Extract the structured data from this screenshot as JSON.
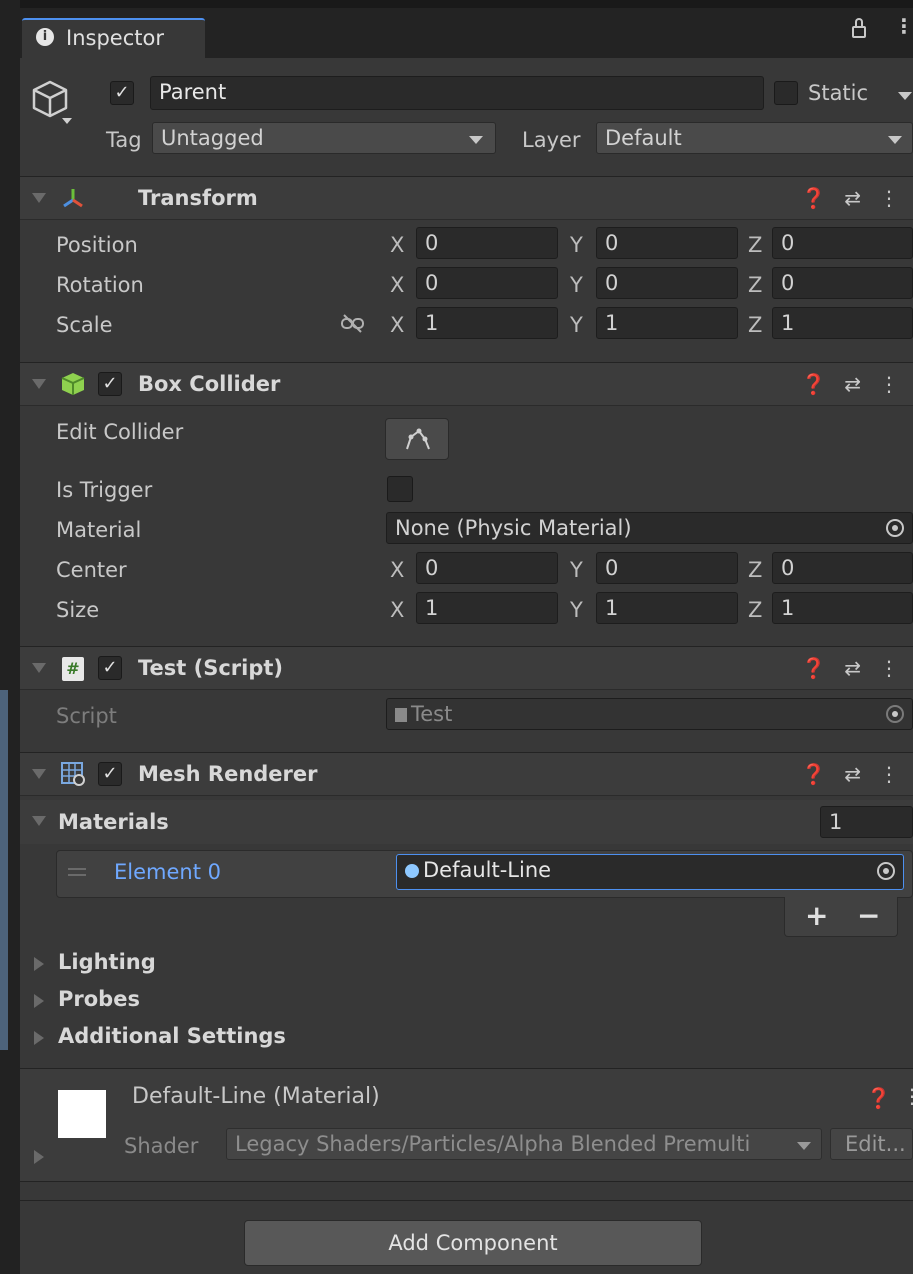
{
  "window": {
    "tab_label": "Inspector",
    "tab_icon": "info-icon",
    "lock_icon": "lock-icon",
    "menu_icon": "kebab-menu-icon"
  },
  "gameobject": {
    "name": "Parent",
    "active": true,
    "static_label": "Static",
    "tag_label": "Tag",
    "tag_value": "Untagged",
    "layer_label": "Layer",
    "layer_value": "Default"
  },
  "transform": {
    "title": "Transform",
    "rows": [
      {
        "label": "Position",
        "x": "0",
        "y": "0",
        "z": "0"
      },
      {
        "label": "Rotation",
        "x": "0",
        "y": "0",
        "z": "0"
      },
      {
        "label": "Scale",
        "x": "1",
        "y": "1",
        "z": "1"
      }
    ]
  },
  "axes": {
    "x": "X",
    "y": "Y",
    "z": "Z"
  },
  "box_collider": {
    "title": "Box Collider",
    "enabled": true,
    "edit_label": "Edit Collider",
    "trigger_label": "Is Trigger",
    "material_label": "Material",
    "material_value": "None (Physic Material)",
    "center_label": "Center",
    "center": {
      "x": "0",
      "y": "0",
      "z": "0"
    },
    "size_label": "Size",
    "size": {
      "x": "1",
      "y": "1",
      "z": "1"
    }
  },
  "test_script": {
    "title": "Test (Script)",
    "enabled": true,
    "script_label": "Script",
    "script_value": "Test"
  },
  "mesh_renderer": {
    "title": "Mesh Renderer",
    "enabled": true,
    "materials_label": "Materials",
    "materials_count": "1",
    "element_label": "Element 0",
    "element_value": "Default-Line",
    "add_symbol": "+",
    "remove_symbol": "−",
    "lighting_label": "Lighting",
    "probes_label": "Probes",
    "additional_label": "Additional Settings"
  },
  "material_panel": {
    "title": "Default-Line (Material)",
    "shader_label": "Shader",
    "shader_value": "Legacy Shaders/Particles/Alpha Blended Premulti",
    "edit_label": "Edit..."
  },
  "add_component_label": "Add Component",
  "colors": {
    "panel_bg": "#383838",
    "header_bg": "#3c3c3c",
    "field_bg": "#2a2a2a",
    "accent_blue": "#4d90f0",
    "link_blue": "#6fa8ff"
  }
}
